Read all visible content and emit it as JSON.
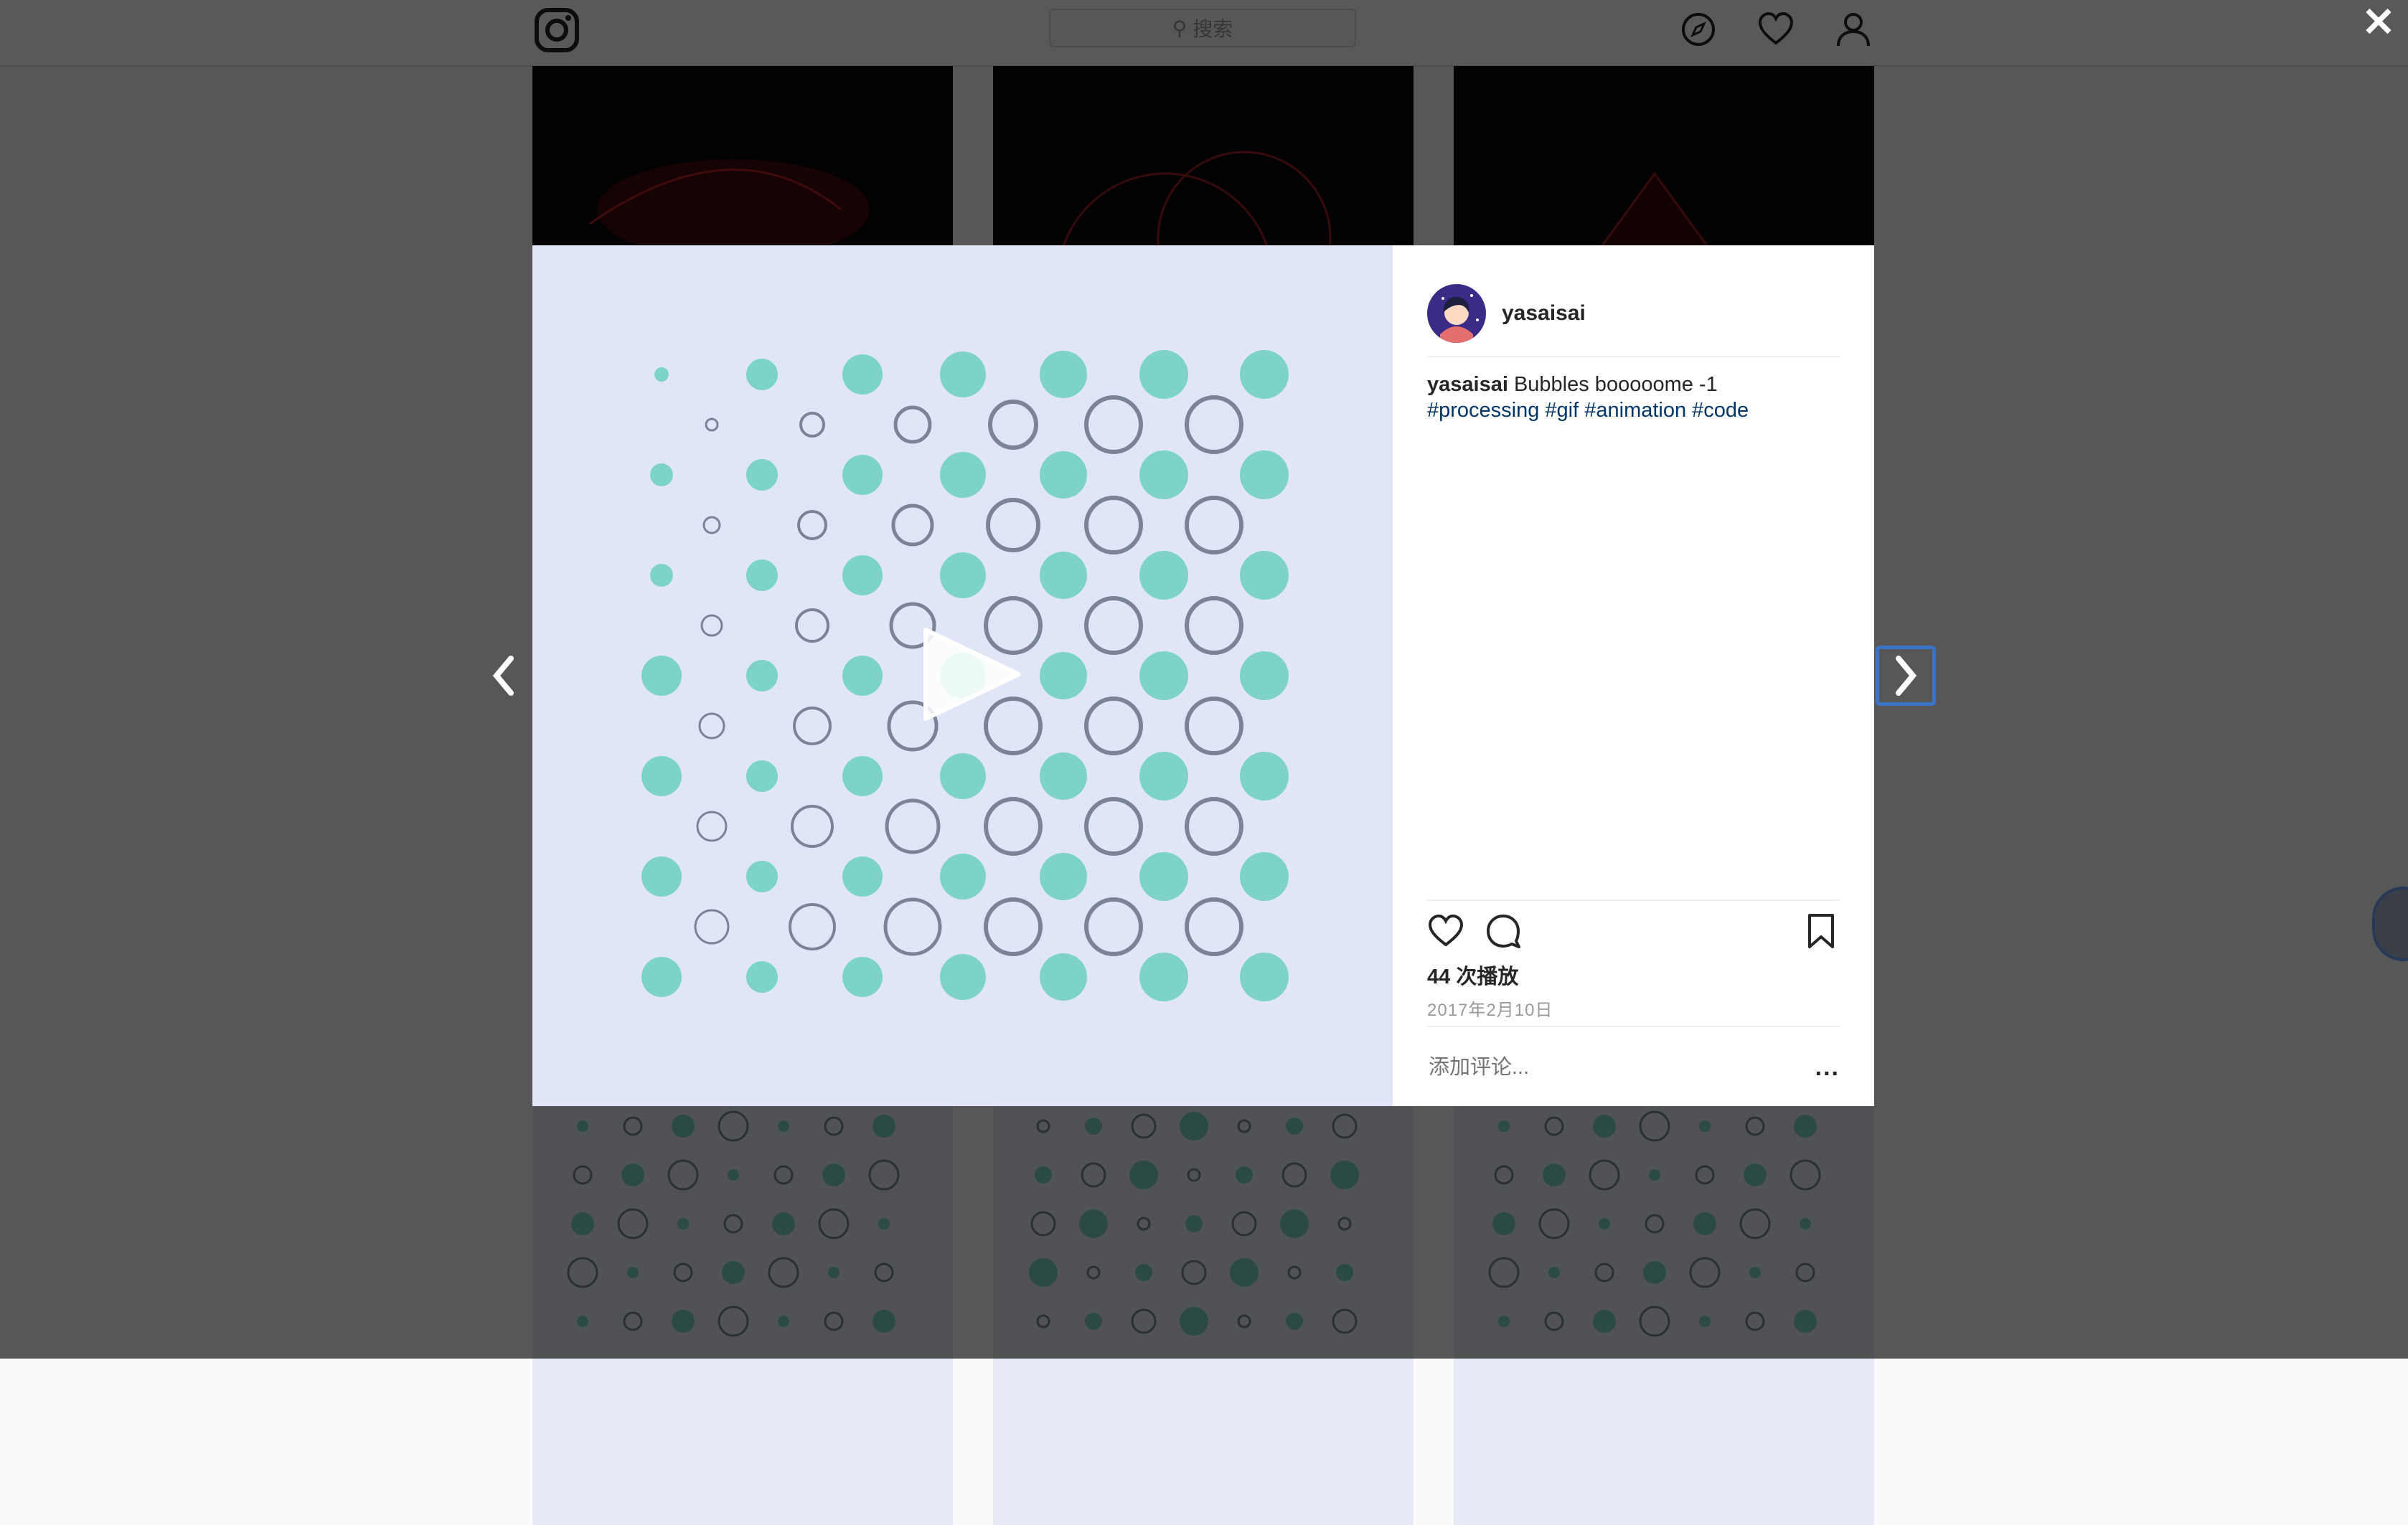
{
  "search": {
    "placeholder": "搜索"
  },
  "post": {
    "username": "yasaisai",
    "caption_user": "yasaisai",
    "caption_text": "Bubbles booooome -1",
    "hashtags": "#processing #gif #animation #code",
    "views": "44 次播放",
    "date": "2017年2月10日",
    "comment_placeholder": "添加评论...",
    "more_label": "..."
  },
  "colors": {
    "teal": "#7dd3c7",
    "ring": "#7b8497",
    "media_bg": "#e0e6f8",
    "hashtag": "#003569"
  },
  "icons": [
    "instagram-logo-icon",
    "search-icon",
    "compass-icon",
    "heart-icon",
    "user-icon",
    "close-icon",
    "chevron-left-icon",
    "chevron-right-icon",
    "play-icon",
    "comment-icon",
    "bookmark-icon",
    "more-icon"
  ]
}
